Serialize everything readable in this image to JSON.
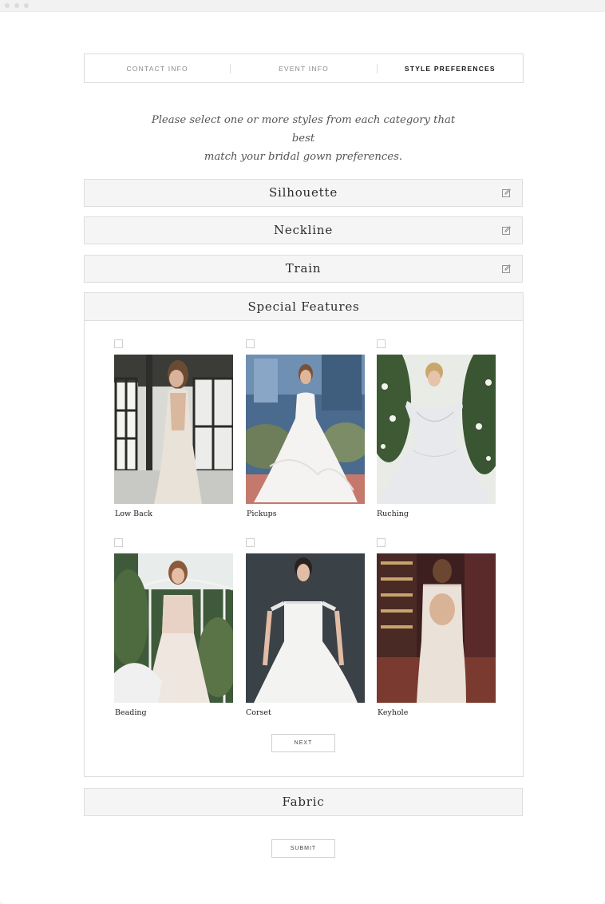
{
  "steps": [
    {
      "label": "CONTACT INFO",
      "active": false
    },
    {
      "label": "EVENT INFO",
      "active": false
    },
    {
      "label": "STYLE PREFERENCES",
      "active": true
    }
  ],
  "intro": {
    "line1": "Please select one or more styles from each category that best",
    "line2": "match your bridal gown preferences."
  },
  "sections": {
    "silhouette": "Silhouette",
    "neckline": "Neckline",
    "train": "Train",
    "special_features": "Special Features",
    "fabric": "Fabric"
  },
  "features": [
    {
      "label": "Low Back",
      "checked": false,
      "icon": "dress-photo"
    },
    {
      "label": "Pickups",
      "checked": false,
      "icon": "dress-photo"
    },
    {
      "label": "Ruching",
      "checked": false,
      "icon": "dress-photo"
    },
    {
      "label": "Beading",
      "checked": false,
      "icon": "dress-photo"
    },
    {
      "label": "Corset",
      "checked": false,
      "icon": "dress-photo"
    },
    {
      "label": "Keyhole",
      "checked": false,
      "icon": "dress-photo"
    }
  ],
  "buttons": {
    "next": "NEXT",
    "submit": "SUBMIT"
  },
  "icons": {
    "edit": "edit-icon"
  },
  "colors": {
    "section_bg": "#f5f5f5",
    "border": "#dedede",
    "active_step": "#1a1a1a"
  }
}
